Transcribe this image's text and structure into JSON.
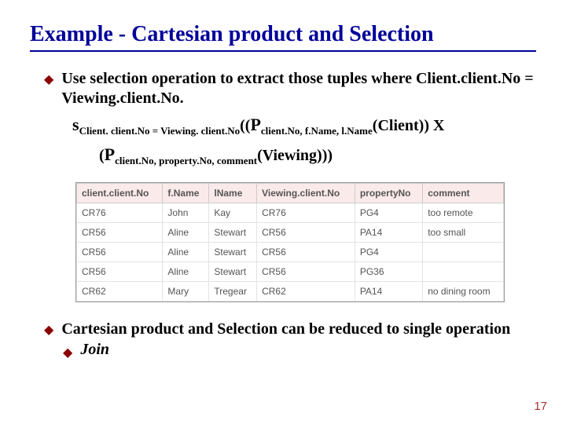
{
  "title": "Example - Cartesian product and Selection",
  "point1": "Use selection operation to extract those tuples where Client.client.No = Viewing.client.No.",
  "formula": {
    "sigma": "s",
    "sigma_sub": "Client. client.No = Viewing. client.No",
    "pi": "P",
    "pi1_sub": "client.No, f.Name, l.Name",
    "pi1_arg": "(Client)) X",
    "pi2_sub": "client.No, property.No, comment",
    "pi2_arg": "(Viewing)))"
  },
  "table": {
    "headers": [
      "client.client.No",
      "f.Name",
      "lName",
      "Viewing.client.No",
      "propertyNo",
      "comment"
    ],
    "rows": [
      [
        "CR76",
        "John",
        "Kay",
        "CR76",
        "PG4",
        "too remote"
      ],
      [
        "CR56",
        "Aline",
        "Stewart",
        "CR56",
        "PA14",
        "too small"
      ],
      [
        "CR56",
        "Aline",
        "Stewart",
        "CR56",
        "PG4",
        ""
      ],
      [
        "CR56",
        "Aline",
        "Stewart",
        "CR56",
        "PG36",
        ""
      ],
      [
        "CR62",
        "Mary",
        "Tregear",
        "CR62",
        "PA14",
        "no dining room"
      ]
    ]
  },
  "point2": "Cartesian product and Selection can be reduced to single operation",
  "join": "Join",
  "pageNum": "17"
}
